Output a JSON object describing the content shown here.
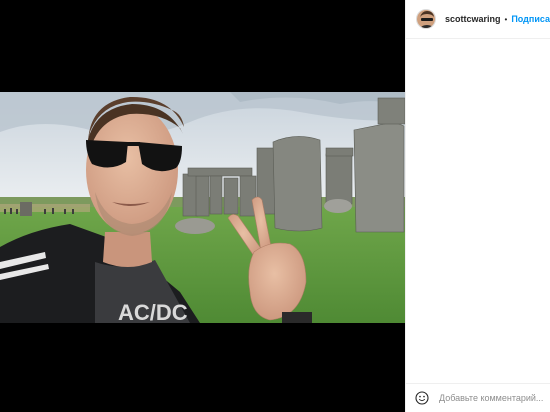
{
  "post": {
    "username": "scottcwaring",
    "separator": "•",
    "follow_label": "Подписаться"
  },
  "comment": {
    "placeholder": "Добавьте комментарий..."
  },
  "photo": {
    "shirt_text": "AC/DC"
  },
  "icons": {
    "avatar": "avatar",
    "emoji": "smiley-face-icon"
  }
}
